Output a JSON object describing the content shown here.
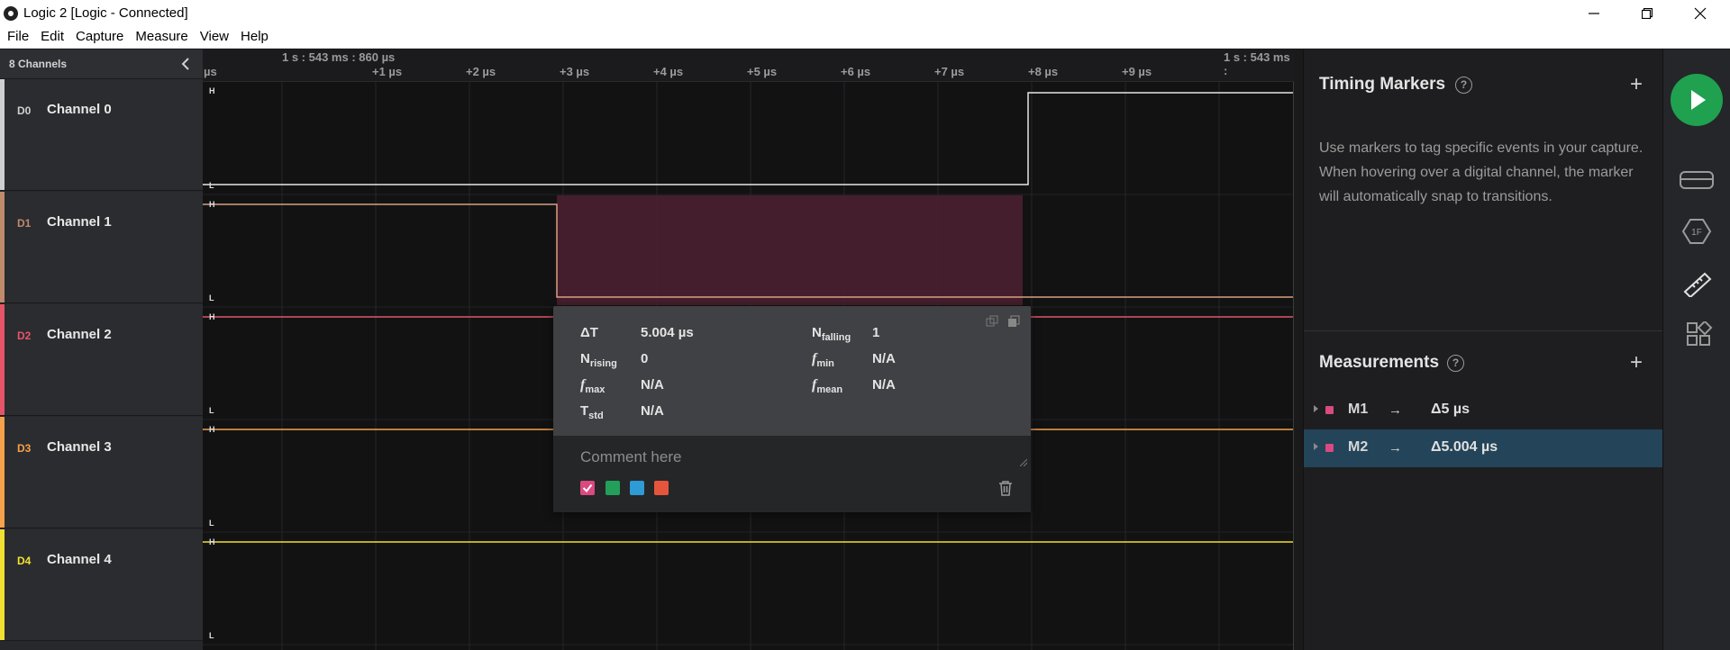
{
  "window": {
    "title": "Logic 2 [Logic - Connected]"
  },
  "menu": [
    "File",
    "Edit",
    "Capture",
    "Measure",
    "View",
    "Help"
  ],
  "channels_panel": {
    "header": "8 Channels",
    "channels": [
      {
        "id": "D0",
        "name": "Channel 0",
        "color": "#cfcfcf"
      },
      {
        "id": "D1",
        "name": "Channel 1",
        "color": "#c08a6b"
      },
      {
        "id": "D2",
        "name": "Channel 2",
        "color": "#e5556a"
      },
      {
        "id": "D3",
        "name": "Channel 3",
        "color": "#f5a24a"
      },
      {
        "id": "D4",
        "name": "Channel 4",
        "color": "#f0e032"
      }
    ]
  },
  "ruler": {
    "start_label": "1 s : 543 ms : 860 µs",
    "end_label": "1 s : 543 ms :",
    "left_edge_label": "µs",
    "ticks": [
      "+1 µs",
      "+2 µs",
      "+3 µs",
      "+4 µs",
      "+5 µs",
      "+6 µs",
      "+7 µs",
      "+8 µs",
      "+9 µs"
    ]
  },
  "level_labels": {
    "high": "H",
    "low": "L"
  },
  "popup": {
    "delta_t_label": "ΔT",
    "delta_t_value": "5.004 µs",
    "n_falling_label": "N",
    "n_falling_sub": "falling",
    "n_falling_value": "1",
    "n_rising_label": "N",
    "n_rising_sub": "rising",
    "n_rising_value": "0",
    "f_min_label": "f",
    "f_min_sub": "min",
    "f_min_value": "N/A",
    "f_max_label": "f",
    "f_max_sub": "max",
    "f_max_value": "N/A",
    "f_mean_label": "f",
    "f_mean_sub": "mean",
    "f_mean_value": "N/A",
    "t_std_label": "T",
    "t_std_sub": "std",
    "t_std_value": "N/A",
    "comment_placeholder": "Comment here",
    "swatches": [
      "#d94a80",
      "#22a05a",
      "#2e9ad6",
      "#e5553b"
    ]
  },
  "timing_markers": {
    "title": "Timing Markers",
    "help": "?",
    "add": "+",
    "description": "Use markers to tag specific events in your capture. When hovering over a digital channel, the marker will automatically snap to transitions."
  },
  "measurements": {
    "title": "Measurements",
    "help": "?",
    "add": "+",
    "items": [
      {
        "name": "M1",
        "goto": "→",
        "value": "Δ5 µs"
      },
      {
        "name": "M2",
        "goto": "→",
        "value": "Δ5.004 µs"
      }
    ]
  },
  "rail_icons": [
    "play-icon",
    "analyzer-icon",
    "extension-icon",
    "measure-ruler-icon",
    "layout-icon"
  ]
}
